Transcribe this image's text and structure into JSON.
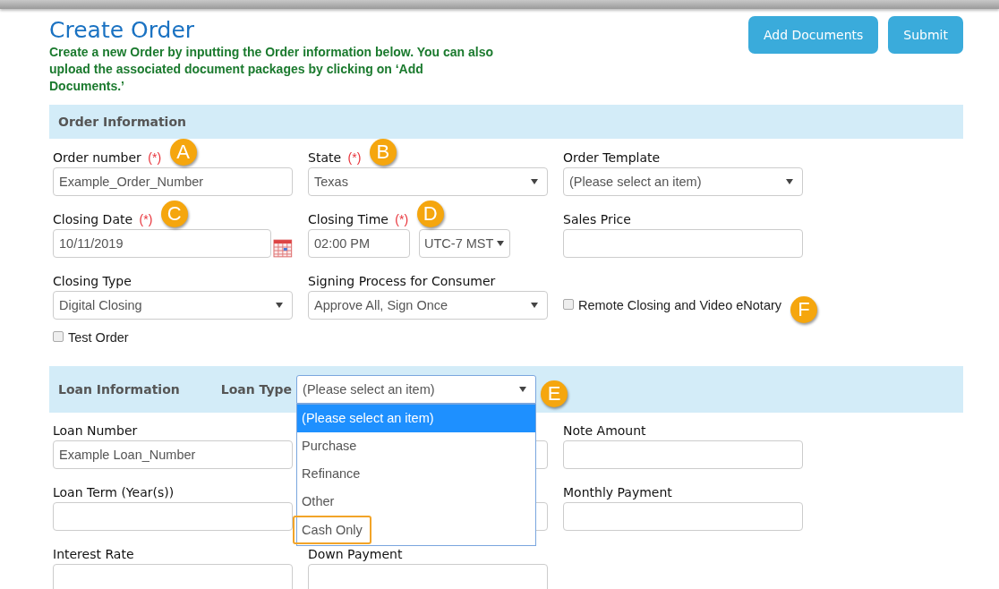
{
  "header": {
    "title": "Create Order",
    "description": "Create a new Order by inputting the Order information below. You can also upload the associated document packages by clicking on ‘Add Documents.’",
    "buttons": [
      {
        "label": "Add Documents"
      },
      {
        "label": "Submit"
      }
    ]
  },
  "order_information": {
    "title": "Order Information",
    "rows": [
      [
        {
          "kind": "text",
          "label": "Order number",
          "required_mark": "(*)",
          "value": "Example_Order_Number",
          "callout": "A"
        },
        {
          "kind": "select",
          "label": "State",
          "required_mark": "(*)",
          "value": "Texas",
          "callout": "B"
        },
        {
          "kind": "select",
          "label": "Order Template",
          "value": "(Please select an item)"
        }
      ],
      [
        {
          "kind": "date",
          "label": "Closing Date",
          "required_mark": "(*)",
          "value": "10/11/2019",
          "callout": "C"
        },
        {
          "kind": "time",
          "label": "Closing Time",
          "required_mark": "(*)",
          "value": "02:00 PM",
          "zone": "UTC-7 MST",
          "callout": "D"
        },
        {
          "kind": "text",
          "label": "Sales Price"
        }
      ],
      [
        {
          "kind": "select",
          "label": "Closing Type",
          "value": "Digital Closing"
        },
        {
          "kind": "select",
          "label": "Signing Process for Consumer",
          "value": "Approve All, Sign Once"
        },
        {
          "kind": "checkbox",
          "label": "Remote Closing and Video eNotary",
          "checked": false,
          "callout": "F"
        }
      ],
      [
        {
          "kind": "checkbox",
          "label": "Test Order",
          "checked": false
        }
      ]
    ]
  },
  "loan_information": {
    "title": "Loan Information",
    "loan_type": {
      "label": "Loan Type",
      "value": "(Please select an item)",
      "callout": "E",
      "expanded": true,
      "options": [
        {
          "label": "(Please select an item)",
          "selected": true,
          "highlighted": false
        },
        {
          "label": "Purchase",
          "selected": false,
          "highlighted": false
        },
        {
          "label": "Refinance",
          "selected": false,
          "highlighted": false
        },
        {
          "label": "Other",
          "selected": false,
          "highlighted": false
        },
        {
          "label": "Cash Only",
          "selected": false,
          "highlighted": true
        }
      ]
    },
    "rows": [
      [
        {
          "kind": "text",
          "label": "Loan Number",
          "value": "Example Loan_Number"
        },
        {
          "kind": "text"
        },
        {
          "kind": "text",
          "label": "Note Amount"
        }
      ],
      [
        {
          "kind": "text",
          "label": "Loan Term (Year(s))"
        },
        {
          "kind": "text"
        },
        {
          "kind": "text",
          "label": "Monthly Payment"
        }
      ],
      [
        {
          "kind": "text",
          "label": "Interest Rate"
        },
        {
          "kind": "text",
          "label": "Down Payment"
        }
      ]
    ]
  }
}
